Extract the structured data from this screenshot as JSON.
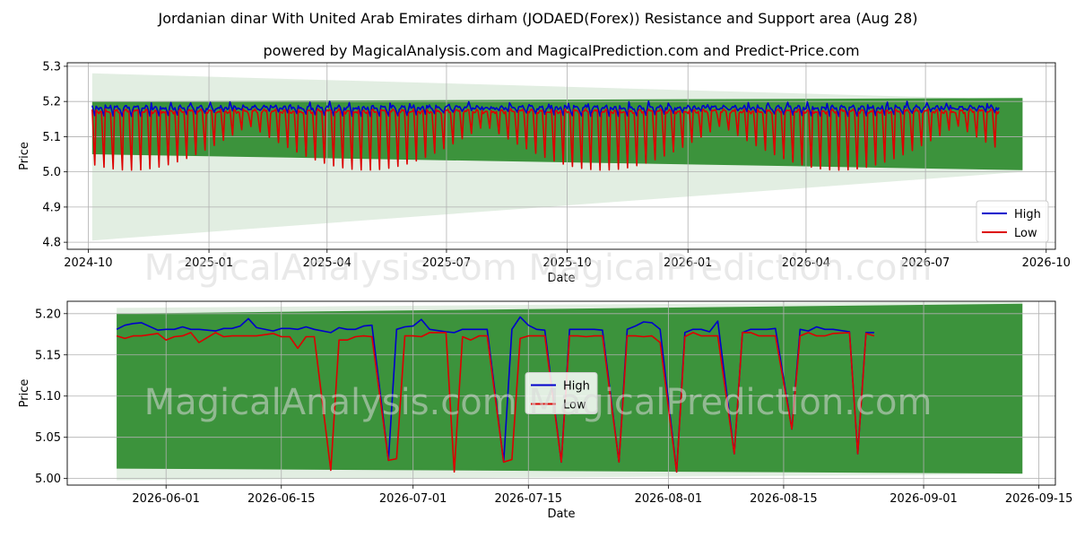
{
  "header": {
    "title": "Jordanian dinar With United Arab Emirates dirham (JODAED(Forex)) Resistance and Support area (Aug 28)",
    "subtitle": "powered by MagicalAnalysis.com and MagicalPrediction.com and Predict-Price.com"
  },
  "watermarks": {
    "top": "MagicalAnalysis.com     MagicalPrediction.com",
    "bottom": "MagicalAnalysis.com     MagicalPrediction.com"
  },
  "colors": {
    "high": "#0000cc",
    "low": "#dd0000",
    "band": "#2e8b2e",
    "band_light": "#cfe3cf",
    "grid": "#b0b0b0"
  },
  "chart_data": [
    {
      "type": "line",
      "xlabel": "Date",
      "ylabel": "Price",
      "ylim": [
        4.78,
        5.31
      ],
      "xlim": [
        "2024-09-15",
        "2026-10-08"
      ],
      "x_ticks": [
        "2024-10",
        "2025-01",
        "2025-04",
        "2025-07",
        "2025-10",
        "2026-01",
        "2026-04",
        "2026-07",
        "2026-10"
      ],
      "y_ticks": [
        "4.8",
        "4.9",
        "5.0",
        "5.1",
        "5.2",
        "5.3"
      ],
      "x_range": [
        "2024-10-04",
        "2026-08-26"
      ],
      "series": [
        {
          "name": "High",
          "base": 5.183,
          "dip_min": 5.15
        },
        {
          "name": "Low",
          "base": 5.172,
          "dip_min": 5.005
        }
      ],
      "bands": {
        "outer_light": {
          "start": [
            "2024-10-04",
            4.805,
            5.28
          ],
          "end": [
            "2026-09-13",
            5.0,
            5.205
          ]
        },
        "inner": {
          "start": [
            "2024-10-04",
            5.05,
            5.2
          ],
          "end": [
            "2026-09-13",
            5.005,
            5.21
          ]
        }
      },
      "legend": {
        "position": "lower-right",
        "entries": [
          "High",
          "Low"
        ]
      },
      "grid": true
    },
    {
      "type": "line",
      "xlabel": "Date",
      "ylabel": "Price",
      "ylim": [
        4.992,
        5.215
      ],
      "xlim": [
        "2026-05-20",
        "2026-09-17"
      ],
      "x_ticks": [
        "2026-06-01",
        "2026-06-15",
        "2026-07-01",
        "2026-07-15",
        "2026-08-01",
        "2026-08-15",
        "2026-09-01",
        "2026-09-15"
      ],
      "y_ticks": [
        "5.00",
        "5.05",
        "5.10",
        "5.15",
        "5.20"
      ],
      "x": [
        "2026-05-26",
        "2026-05-27",
        "2026-05-28",
        "2026-05-29",
        "2026-05-31",
        "2026-06-01",
        "2026-06-02",
        "2026-06-03",
        "2026-06-04",
        "2026-06-05",
        "2026-06-07",
        "2026-06-08",
        "2026-06-09",
        "2026-06-10",
        "2026-06-11",
        "2026-06-12",
        "2026-06-14",
        "2026-06-15",
        "2026-06-16",
        "2026-06-17",
        "2026-06-18",
        "2026-06-19",
        "2026-06-21",
        "2026-06-22",
        "2026-06-23",
        "2026-06-24",
        "2026-06-25",
        "2026-06-26",
        "2026-06-28",
        "2026-06-29",
        "2026-06-30",
        "2026-07-01",
        "2026-07-02",
        "2026-07-03",
        "2026-07-05",
        "2026-07-06",
        "2026-07-07",
        "2026-07-08",
        "2026-07-09",
        "2026-07-10",
        "2026-07-12",
        "2026-07-13",
        "2026-07-14",
        "2026-07-15",
        "2026-07-16",
        "2026-07-17",
        "2026-07-19",
        "2026-07-20",
        "2026-07-21",
        "2026-07-22",
        "2026-07-23",
        "2026-07-24",
        "2026-07-26",
        "2026-07-27",
        "2026-07-28",
        "2026-07-29",
        "2026-07-30",
        "2026-07-31",
        "2026-08-02",
        "2026-08-03",
        "2026-08-04",
        "2026-08-05",
        "2026-08-06",
        "2026-08-07",
        "2026-08-09",
        "2026-08-10",
        "2026-08-11",
        "2026-08-12",
        "2026-08-13",
        "2026-08-14",
        "2026-08-16",
        "2026-08-17",
        "2026-08-18",
        "2026-08-19",
        "2026-08-20",
        "2026-08-21",
        "2026-08-23",
        "2026-08-24",
        "2026-08-25",
        "2026-08-26"
      ],
      "series": [
        {
          "name": "High",
          "values": [
            5.181,
            5.186,
            5.188,
            5.189,
            5.18,
            5.181,
            5.181,
            5.184,
            5.181,
            5.181,
            5.179,
            5.182,
            5.182,
            5.185,
            5.194,
            5.183,
            5.179,
            5.182,
            5.182,
            5.181,
            5.184,
            5.181,
            5.177,
            5.183,
            5.181,
            5.181,
            5.185,
            5.186,
            5.022,
            5.181,
            5.184,
            5.185,
            5.193,
            5.181,
            5.178,
            5.177,
            5.181,
            5.181,
            5.181,
            5.181,
            5.02,
            5.181,
            5.196,
            5.186,
            5.181,
            5.18,
            5.02,
            5.181,
            5.181,
            5.181,
            5.181,
            5.18,
            5.02,
            5.181,
            5.185,
            5.19,
            5.189,
            5.181,
            5.008,
            5.177,
            5.181,
            5.181,
            5.178,
            5.191,
            5.03,
            5.177,
            5.181,
            5.181,
            5.181,
            5.182,
            5.06,
            5.181,
            5.179,
            5.184,
            5.181,
            5.181,
            5.178,
            5.03,
            5.177,
            5.177
          ]
        },
        {
          "name": "Low",
          "values": [
            5.173,
            5.17,
            5.173,
            5.173,
            5.176,
            5.168,
            5.172,
            5.173,
            5.177,
            5.165,
            5.177,
            5.172,
            5.173,
            5.173,
            5.173,
            5.173,
            5.176,
            5.172,
            5.172,
            5.158,
            5.172,
            5.172,
            5.01,
            5.168,
            5.168,
            5.172,
            5.173,
            5.172,
            5.022,
            5.024,
            5.173,
            5.173,
            5.172,
            5.177,
            5.177,
            5.008,
            5.172,
            5.168,
            5.173,
            5.173,
            5.02,
            5.023,
            5.17,
            5.173,
            5.173,
            5.173,
            5.02,
            5.173,
            5.173,
            5.172,
            5.173,
            5.173,
            5.02,
            5.173,
            5.173,
            5.172,
            5.173,
            5.165,
            5.008,
            5.172,
            5.177,
            5.173,
            5.173,
            5.173,
            5.03,
            5.177,
            5.177,
            5.173,
            5.173,
            5.173,
            5.06,
            5.173,
            5.177,
            5.173,
            5.173,
            5.176,
            5.177,
            5.03,
            5.176,
            5.173
          ]
        }
      ],
      "bands": {
        "outer_light": {
          "start": [
            "2026-05-26",
            4.998,
            5.207
          ],
          "end": [
            "2026-09-13",
            5.005,
            5.215
          ]
        },
        "inner": {
          "start": [
            "2026-05-26",
            5.012,
            5.2
          ],
          "end": [
            "2026-09-13",
            5.006,
            5.212
          ]
        }
      },
      "legend": {
        "position": "center",
        "entries": [
          "High",
          "Low"
        ]
      },
      "grid": true
    }
  ]
}
